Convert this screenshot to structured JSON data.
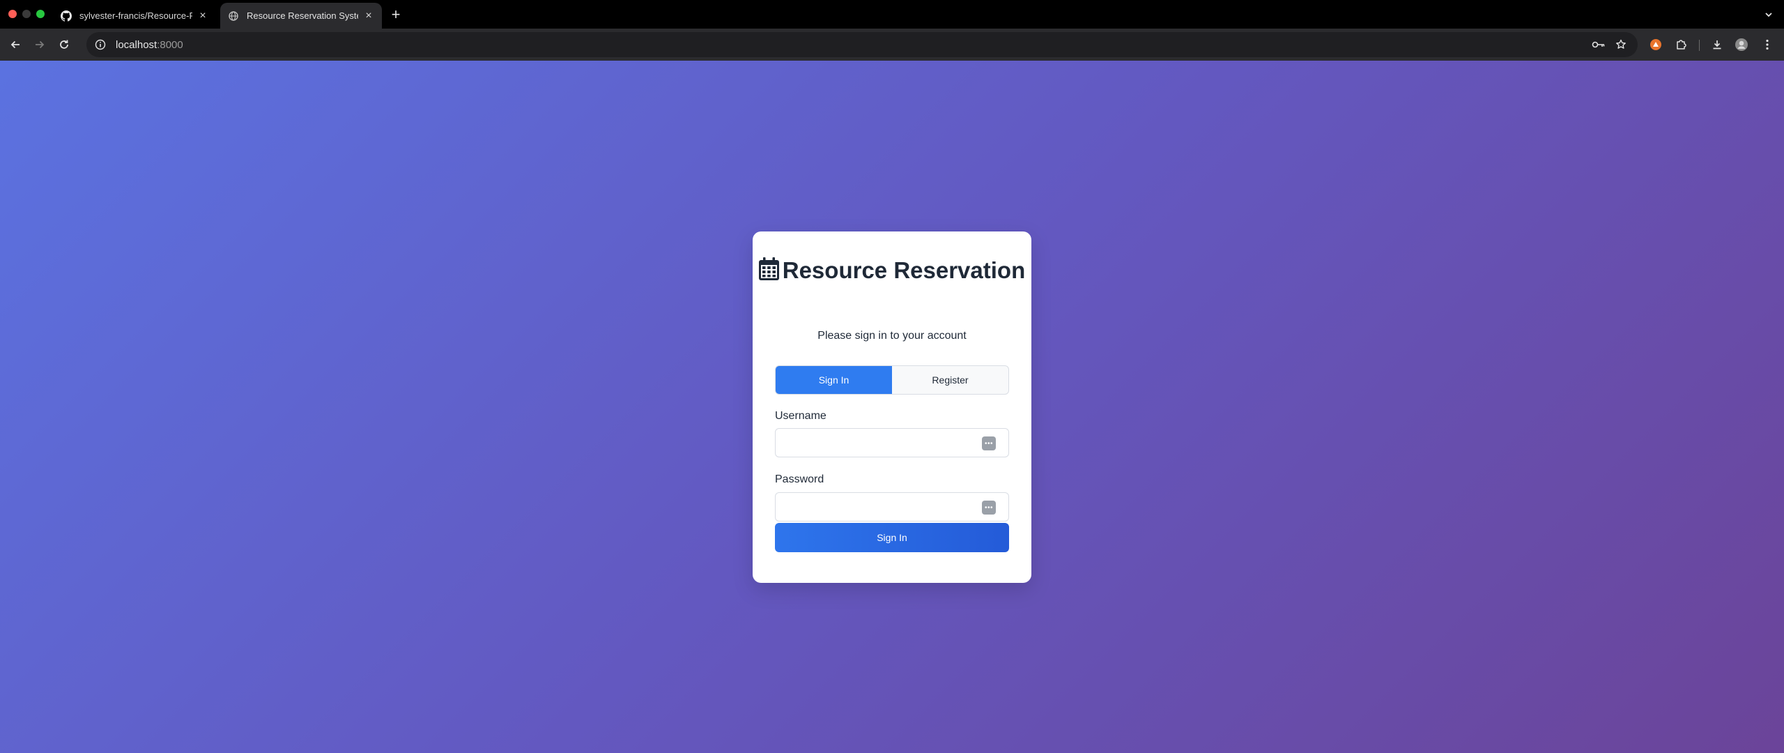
{
  "browser": {
    "tabs": [
      {
        "title": "sylvester-francis/Resource-R",
        "favicon": "github-icon",
        "active": false
      },
      {
        "title": "Resource Reservation System",
        "favicon": "globe-icon",
        "active": true
      }
    ],
    "address": {
      "host": "localhost",
      "port": ":8000"
    }
  },
  "login": {
    "title": "Resource Reservation",
    "title_icon": "calendar-icon",
    "subtitle": "Please sign in to your account",
    "tabs": {
      "sign_in": "Sign In",
      "register": "Register",
      "active": "sign_in"
    },
    "username_label": "Username",
    "username_value": "",
    "password_label": "Password",
    "password_value": "",
    "submit_label": "Sign In"
  },
  "colors": {
    "primary": "#2f7cf0",
    "gradient_start": "#5b72e0",
    "gradient_end": "#6b4499",
    "text": "#1f2937"
  }
}
